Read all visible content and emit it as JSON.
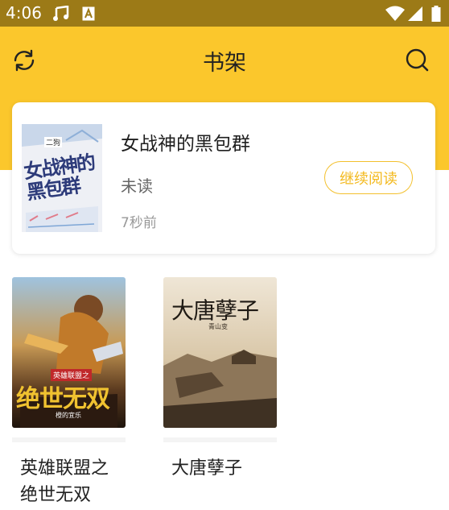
{
  "status_bar": {
    "time": "4:06",
    "icons": [
      "music-note-icon",
      "a-letter-icon",
      "wifi-icon",
      "signal-icon",
      "battery-icon"
    ]
  },
  "header": {
    "title": "书架",
    "left_icon": "refresh-icon",
    "right_icon": "search-icon"
  },
  "recent": {
    "title": "女战神的黑包群",
    "status": "未读",
    "time": "7秒前",
    "continue_label": "继续阅读",
    "cover_text": "女战神的黑包群",
    "cover_author": "二狗"
  },
  "books": [
    {
      "title": "英雄联盟之绝世无双",
      "cover_title": "绝世无双",
      "cover_subtitle": "英雄联盟之",
      "cover_author": "橙的宜乐"
    },
    {
      "title": "大唐孽子",
      "cover_title": "大唐孽子",
      "cover_author": "青山变"
    }
  ],
  "colors": {
    "accent": "#fbc72c",
    "status_bar": "#9c7a17",
    "button_border": "#f3c02d"
  }
}
